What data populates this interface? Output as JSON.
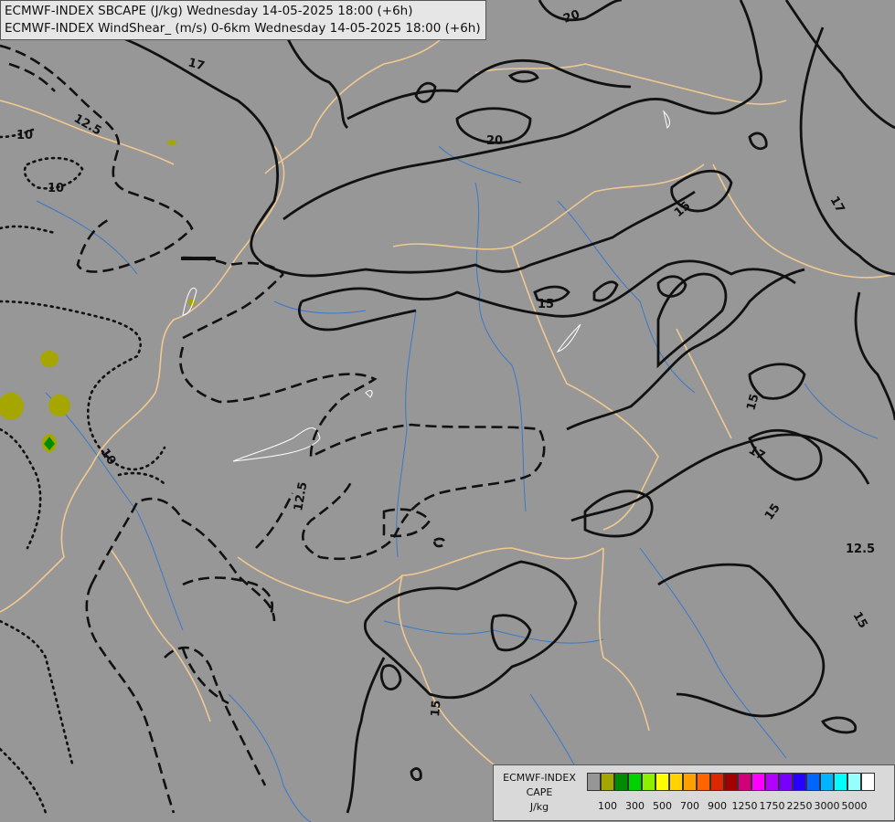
{
  "header": {
    "line1": "ECMWF-INDEX SBCAPE (J/kg) Wednesday 14-05-2025 18:00 (+6h)",
    "line2": "ECMWF-INDEX WindShear_ (m/s) 0-6km Wednesday 14-05-2025 18:00 (+6h)"
  },
  "map": {
    "background_color": "#979797",
    "border_color": "#f0c890",
    "river_color": "#3a78c9",
    "contour_labels": [
      "20",
      "17",
      "12.5",
      "10",
      "10",
      "20",
      "15",
      "15",
      "17",
      "15",
      "15",
      "12.5",
      "17",
      "15",
      "12.5",
      "10",
      "15"
    ]
  },
  "legend": {
    "title_line1": "ECMWF-INDEX",
    "title_line2": "CAPE",
    "unit": "J/kg",
    "colors": [
      "#969696",
      "#a6a600",
      "#008c00",
      "#00d200",
      "#8cf000",
      "#ffff00",
      "#ffd200",
      "#ffa000",
      "#ff6400",
      "#dc2800",
      "#a00000",
      "#d20078",
      "#ff00ff",
      "#b400ff",
      "#7800ff",
      "#2800ff",
      "#0064ff",
      "#00b4ff",
      "#00ffff",
      "#96ffff",
      "#ffffff"
    ],
    "ticks": [
      "100",
      "300",
      "500",
      "700",
      "900",
      "1250",
      "1750",
      "2250",
      "3000",
      "5000"
    ]
  }
}
